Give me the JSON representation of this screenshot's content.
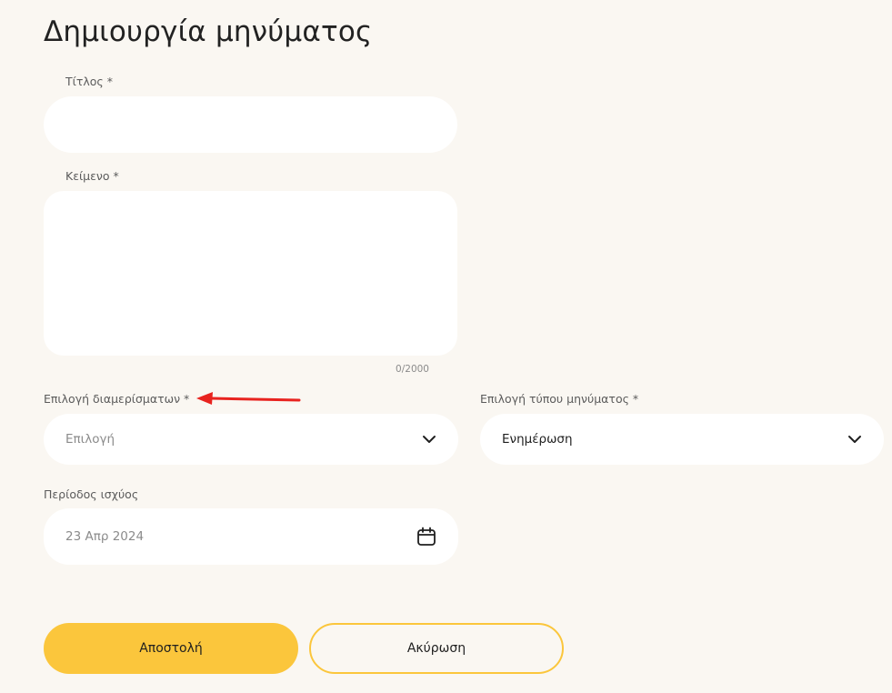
{
  "page": {
    "title": "Δημιουργία μηνύματος"
  },
  "form": {
    "title_field": {
      "label": "Τίτλος *",
      "value": ""
    },
    "body_field": {
      "label": "Κείμενο *",
      "value": "",
      "counter": "0/2000"
    },
    "apartments_select": {
      "label": "Επιλογή διαμερίσματων *",
      "placeholder": "Επιλογή",
      "icon": "chevron-down-icon"
    },
    "message_type_select": {
      "label": "Επιλογή τύπου μηνύματος *",
      "value": "Ενημέρωση",
      "icon": "chevron-down-icon"
    },
    "validity_period": {
      "label": "Περίοδος ισχύος",
      "value": "23 Απρ 2024",
      "icon": "calendar-icon"
    }
  },
  "actions": {
    "submit_label": "Αποστολή",
    "cancel_label": "Ακύρωση"
  },
  "annotation": {
    "color": "#e8231f",
    "icon": "arrow-left-icon"
  },
  "colors": {
    "background": "#faf7f2",
    "accent": "#fbc63c",
    "field_background": "#ffffff"
  }
}
